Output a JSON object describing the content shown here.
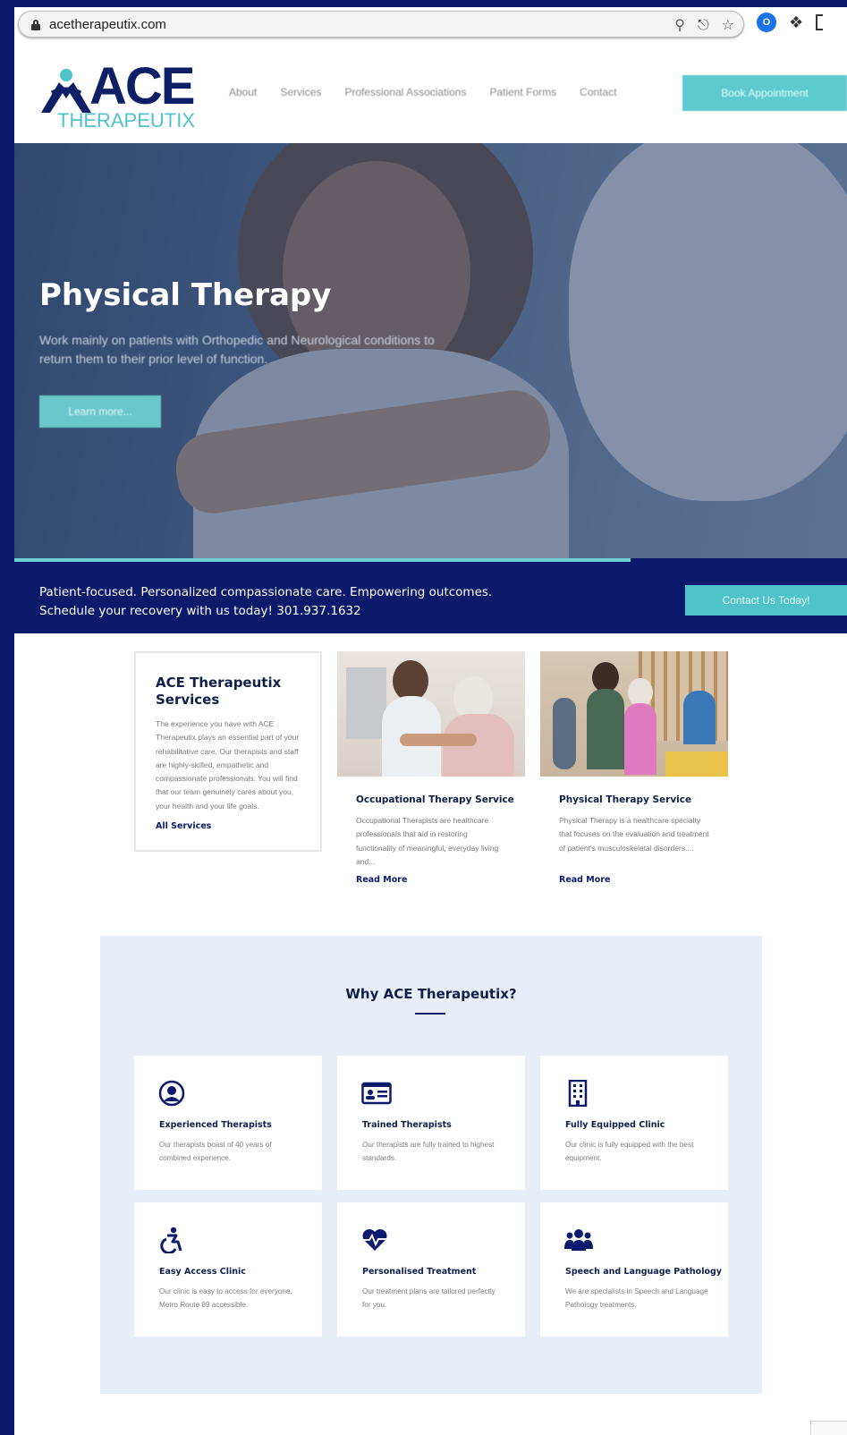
{
  "browser": {
    "url": "acetherapeutix.com",
    "extension_label": "O"
  },
  "header": {
    "logo_main": "ACE",
    "logo_sub": "THERAPEUTIX",
    "nav": [
      "About",
      "Services",
      "Professional Associations",
      "Patient Forms",
      "Contact"
    ],
    "book_label": "Book Appointment"
  },
  "hero": {
    "title": "Physical Therapy",
    "description": "Work mainly on patients with Orthopedic and Neurological conditions to return them to their prior level of function.",
    "button_label": "Learn more...",
    "slide_progress_percent": 74
  },
  "strip": {
    "line1": "Patient-focused. Personalized compassionate care. Empowering outcomes.",
    "line2": "Schedule your recovery with us today! 301.937.1632",
    "button_label": "Contact Us Today!"
  },
  "services": {
    "title": "ACE Therapeutix Services",
    "intro": "The experience you have with ACE Therapeutix plays an essential part of your rehabilitative care. Our therapists and staff are highly-skilled, empathetic and compassionate professionals. You will find that our team genuinely cares about you, your health and your life goals.",
    "link_label": "All Services",
    "items": [
      {
        "title": "Occupational Therapy Service",
        "text": "Occupational Therapists are healthcare professionals that aid in restoring functionality of meaningful, everyday living and...",
        "link": "Read More"
      },
      {
        "title": "Physical Therapy Service",
        "text": "Physical Therapy is a healthcare specialty that focuses on the evaluation and treatment of patient's musculoskeletal disorders....",
        "link": "Read More"
      }
    ]
  },
  "why": {
    "title": "Why ACE Therapeutix?",
    "features": [
      {
        "title": "Experienced Therapists",
        "text": "Our therapists boast of 40 years of combined experience.",
        "icon": "user-circle-icon"
      },
      {
        "title": "Trained Therapists",
        "text": "Our therapists are fully trained to highest standards.",
        "icon": "id-card-icon"
      },
      {
        "title": "Fully Equipped Clinic",
        "text": "Our clinic is fully equipped with the best equipment.",
        "icon": "building-icon"
      },
      {
        "title": "Easy Access Clinic",
        "text": "Our clinic is easy to access for everyone, Metro Route 89 accessible.",
        "icon": "accessibility-icon"
      },
      {
        "title": "Personalised Treatment",
        "text": "Our treatment plans are tailored perfectly for you.",
        "icon": "heartbeat-icon"
      },
      {
        "title": "Speech and Language Pathology",
        "text": "We are specialists in Speech and Language Pathology treatments.",
        "icon": "users-group-icon"
      }
    ]
  },
  "colors": {
    "navy": "#0b1a6b",
    "teal": "#4fc3c9",
    "light_panel": "#e7eef8"
  }
}
